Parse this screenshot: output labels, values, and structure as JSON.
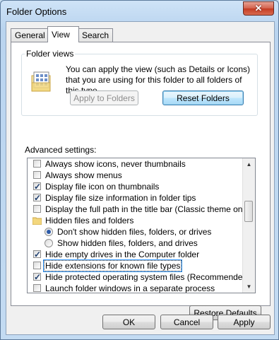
{
  "window": {
    "title": "Folder Options",
    "close_glyph": "✕"
  },
  "tabs": [
    {
      "label": "General",
      "active": false
    },
    {
      "label": "View",
      "active": true
    },
    {
      "label": "Search",
      "active": false
    }
  ],
  "folder_views": {
    "legend": "Folder views",
    "description": "You can apply the view (such as Details or Icons) that you are using for this folder to all folders of this type.",
    "apply_label": "Apply to Folders",
    "reset_label": "Reset Folders",
    "icon": "folder-view-icon"
  },
  "advanced": {
    "heading": "Advanced settings:",
    "items": [
      {
        "type": "checkbox",
        "checked": false,
        "label": "Always show icons, never thumbnails"
      },
      {
        "type": "checkbox",
        "checked": false,
        "label": "Always show menus"
      },
      {
        "type": "checkbox",
        "checked": true,
        "label": "Display file icon on thumbnails"
      },
      {
        "type": "checkbox",
        "checked": true,
        "label": "Display file size information in folder tips"
      },
      {
        "type": "checkbox",
        "checked": false,
        "label": "Display the full path in the title bar (Classic theme only)"
      },
      {
        "type": "folder",
        "label": "Hidden files and folders"
      },
      {
        "type": "radio",
        "checked": true,
        "label": "Don't show hidden files, folders, or drives"
      },
      {
        "type": "radio",
        "checked": false,
        "label": "Show hidden files, folders, and drives"
      },
      {
        "type": "checkbox",
        "checked": true,
        "label": "Hide empty drives in the Computer folder"
      },
      {
        "type": "checkbox",
        "checked": false,
        "selected": true,
        "label": "Hide extensions for known file types"
      },
      {
        "type": "checkbox",
        "checked": true,
        "label": "Hide protected operating system files (Recommended)"
      },
      {
        "type": "checkbox",
        "checked": false,
        "label": "Launch folder windows in a separate process"
      }
    ],
    "restore_label": "Restore Defaults"
  },
  "footer": {
    "ok_label": "OK",
    "cancel_label": "Cancel",
    "apply_label": "Apply"
  }
}
